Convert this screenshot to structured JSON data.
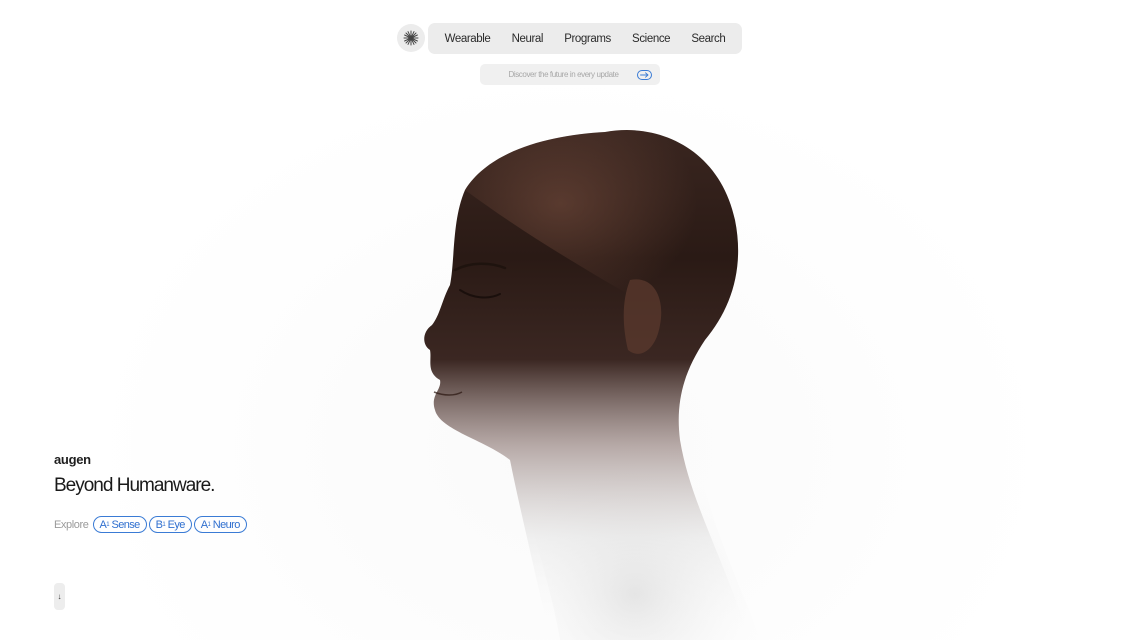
{
  "nav": {
    "logo_icon": "asterisk-burst-icon",
    "items": [
      {
        "label": "Wearable"
      },
      {
        "label": "Neural"
      },
      {
        "label": "Programs"
      },
      {
        "label": "Science"
      },
      {
        "label": "Search"
      }
    ]
  },
  "update_bar": {
    "text": "Discover the future in every update",
    "icon": "arrow-right-icon"
  },
  "hero": {
    "brand": "augen",
    "headline": "Beyond Humanware.",
    "explore_label": "Explore",
    "chips": [
      {
        "prefix": "A",
        "sup": "1",
        "label": "Sense"
      },
      {
        "prefix": "B",
        "sup": "1",
        "label": "Eye"
      },
      {
        "prefix": "A",
        "sup": "1",
        "label": "Neuro"
      }
    ],
    "scroll_icon": "arrow-down-icon",
    "scroll_glyph": "↓"
  },
  "colors": {
    "accent": "#3a7bd5",
    "nav_bg": "#ececec",
    "skin_dark": "#2a1a15",
    "skin_mid": "#5b3a2e"
  }
}
